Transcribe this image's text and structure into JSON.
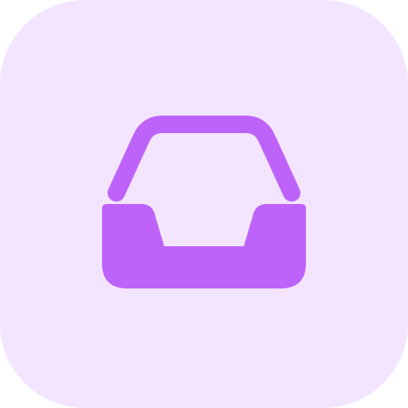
{
  "icon": {
    "name": "inbox-tray-icon",
    "background_color": "#F3E5FE",
    "foreground_color": "#BE63F9"
  }
}
